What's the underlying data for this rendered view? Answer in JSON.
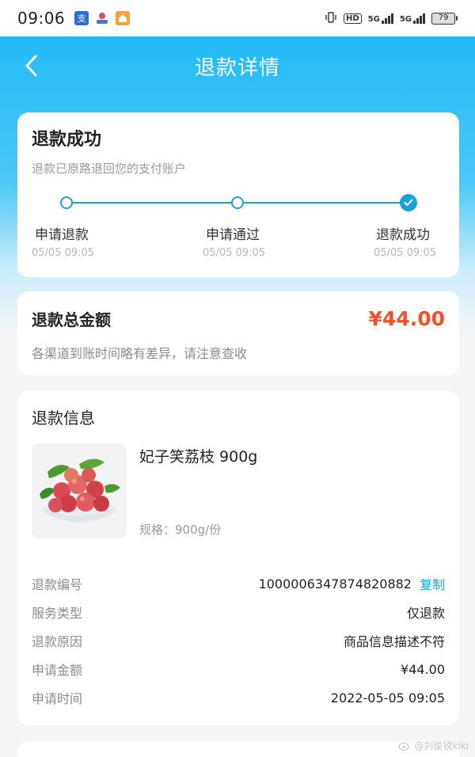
{
  "status_bar": {
    "time": "09:06",
    "network_label": "HD",
    "signal1": "5G",
    "signal2": "5G",
    "battery": "79"
  },
  "navbar": {
    "title": "退款详情",
    "back_icon": "chevron-left-icon"
  },
  "refund_status": {
    "title": "退款成功",
    "subtitle": "退款已原路退回您的支付账户",
    "steps": [
      {
        "label": "申请退款",
        "time": "05/05 09:05",
        "state": "done"
      },
      {
        "label": "申请通过",
        "time": "05/05 09:05",
        "state": "done"
      },
      {
        "label": "退款成功",
        "time": "05/05 09:05",
        "state": "current"
      }
    ]
  },
  "refund_total": {
    "label": "退款总金额",
    "amount": "¥44.00",
    "hint": "各渠道到账时间略有差异，请注意查收"
  },
  "refund_info": {
    "section_title": "退款信息",
    "product": {
      "name": "妃子笑荔枝 900g",
      "spec": "规格：900g/份",
      "image_icon": "lychee-image"
    },
    "rows": [
      {
        "key": "退款编号",
        "value": "1000006347874820882",
        "action": "复制"
      },
      {
        "key": "服务类型",
        "value": "仅退款"
      },
      {
        "key": "退款原因",
        "value": "商品信息描述不符"
      },
      {
        "key": "申请金额",
        "value": "¥44.00"
      },
      {
        "key": "申请时间",
        "value": "2022-05-05 09:05"
      }
    ]
  },
  "watermark": "@刘俊锐kiki",
  "colors": {
    "accent": "#1aa3d9",
    "amount_red": "#f0522c",
    "header_gradient_top": "#19b7f5"
  }
}
